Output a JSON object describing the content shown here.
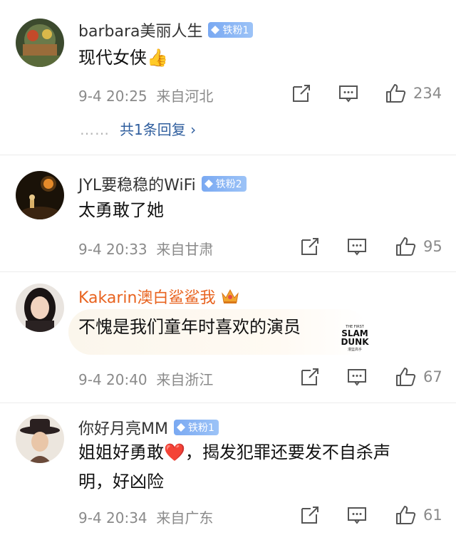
{
  "comments": [
    {
      "username": "barbara美丽人生",
      "badge": "铁粉1",
      "text": "现代女侠👍",
      "time": "9-4 20:25",
      "location": "来自河北",
      "likes": "234",
      "replies_label": "共1条回复 ›",
      "reply_dots": "……"
    },
    {
      "username": "JYL要稳稳的WiFi",
      "badge": "铁粉2",
      "text": "太勇敢了她",
      "time": "9-4 20:33",
      "location": "来自甘肃",
      "likes": "95"
    },
    {
      "username": "Kakarin澳白鲨鲨我",
      "text": "不愧是我们童年时喜欢的演员",
      "time": "9-4 20:40",
      "location": "来自浙江",
      "likes": "67",
      "sticker_text": [
        "THE FIRST",
        "SLAM",
        "DUNK",
        "灌篮高手"
      ]
    },
    {
      "username": "你好月亮MM",
      "badge": "铁粉1",
      "text_line1": "姐姐好勇敢❤️，揭发犯罪还要发不自杀声",
      "text_line2": "明，好凶险",
      "time": "9-4 20:34",
      "location": "来自广东",
      "likes": "61"
    }
  ],
  "colors": {
    "vip_name": "#e8631f",
    "reply_link": "#2f5e9e",
    "meta_gray": "#8a8a8a"
  },
  "icons": [
    "repost-icon",
    "comment-icon",
    "like-thumb-icon",
    "diamond-icon",
    "crown-icon"
  ]
}
